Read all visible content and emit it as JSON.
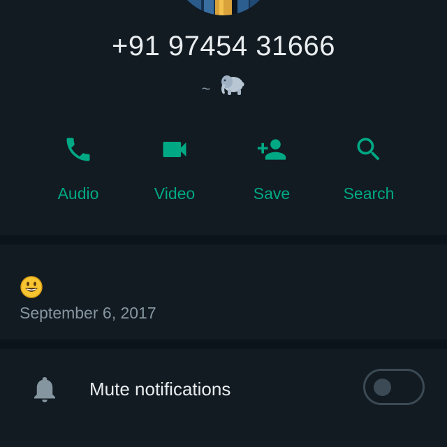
{
  "contact": {
    "phone": "+91 97454 31666",
    "about_prefix": "~",
    "about_icon": "elephant-emoji"
  },
  "actions": [
    {
      "label": "Audio",
      "icon": "phone-icon"
    },
    {
      "label": "Video",
      "icon": "video-camera-icon"
    },
    {
      "label": "Save",
      "icon": "add-person-icon"
    },
    {
      "label": "Search",
      "icon": "search-icon"
    }
  ],
  "status": {
    "icon": "smiley-emoji",
    "date": "September 6, 2017"
  },
  "mute": {
    "label": "Mute notifications",
    "icon": "bell-icon",
    "enabled": false
  },
  "colors": {
    "background": "#121b22",
    "divider": "#0b141a",
    "accent": "#00a884",
    "primary_text": "#e9edef",
    "secondary_text": "#8696a0",
    "toggle_off": "#3b4a54"
  }
}
